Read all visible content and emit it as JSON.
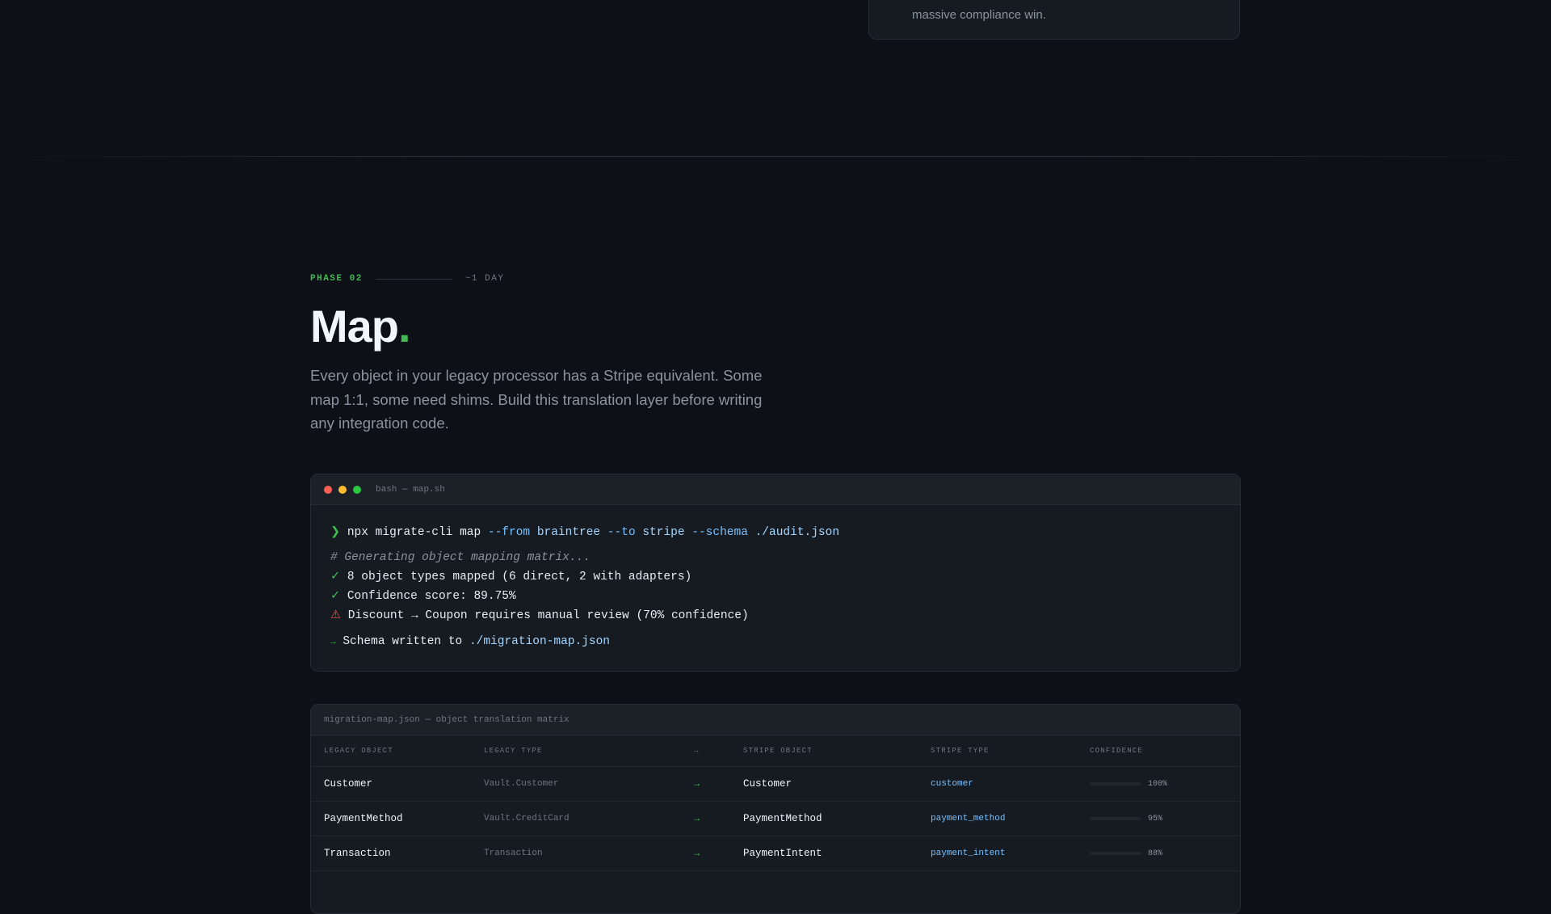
{
  "prev_card": {
    "text": "massive compliance win."
  },
  "phase": {
    "label": "PHASE 02",
    "duration": "~1 DAY"
  },
  "heading": {
    "title": "Map",
    "dot": "."
  },
  "description": "Every object in your legacy processor has a Stripe equivalent. Some map 1:1, some need shims. Build this translation layer before writing any integration code.",
  "terminal": {
    "title": "bash — map.sh",
    "prompt_symbol": "❯",
    "command": "npx migrate-cli map",
    "flag_from": "--from",
    "arg_from": "braintree",
    "flag_to": "--to",
    "arg_to": "stripe",
    "flag_schema": "--schema",
    "arg_schema": "./audit.json",
    "comment": "# Generating object mapping matrix...",
    "check_symbol": "✓",
    "line_mapped": "8 object types mapped (6 direct, 2 with adapters)",
    "line_confidence": "Confidence score: 89.75%",
    "warn_symbol": "⚠",
    "line_warning": "Discount → Coupon requires manual review (70% confidence)",
    "arrow_symbol": "→",
    "line_written": "Schema written to",
    "written_path": "./migration-map.json"
  },
  "table": {
    "caption": "migration-map.json — object translation matrix",
    "columns": [
      "LEGACY OBJECT",
      "LEGACY TYPE",
      "→",
      "STRIPE OBJECT",
      "STRIPE TYPE",
      "CONFIDENCE"
    ],
    "rows": [
      {
        "legacy_object": "Customer",
        "legacy_type": "Vault.Customer",
        "arrow": "→",
        "stripe_object": "Customer",
        "stripe_type": "customer",
        "confidence_label": "100%",
        "confidence": 100,
        "color": "#3fb950"
      },
      {
        "legacy_object": "PaymentMethod",
        "legacy_type": "Vault.CreditCard",
        "arrow": "→",
        "stripe_object": "PaymentMethod",
        "stripe_type": "payment_method",
        "confidence_label": "95%",
        "confidence": 95,
        "color": "#3fb950"
      },
      {
        "legacy_object": "Transaction",
        "legacy_type": "Transaction",
        "arrow": "→",
        "stripe_object": "PaymentIntent",
        "stripe_type": "payment_intent",
        "confidence_label": "88%",
        "confidence": 88,
        "color": "#e3b341"
      }
    ]
  }
}
